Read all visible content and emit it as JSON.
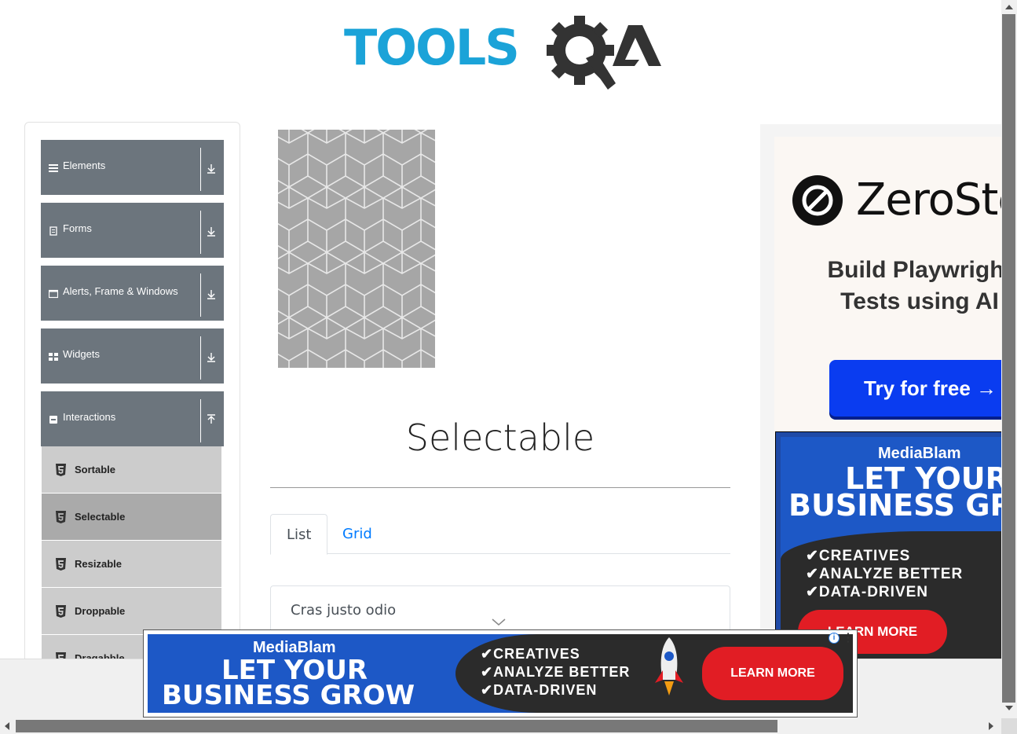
{
  "logo": {
    "text": "TOOLS",
    "qa_text": "A",
    "colors": {
      "primary": "#1ba3d8",
      "dark": "#333333"
    }
  },
  "sidebar": {
    "groups": [
      {
        "label": "Elements",
        "icon": "hamburger-icon"
      },
      {
        "label": "Forms",
        "icon": "form-icon"
      },
      {
        "label": "Alerts, Frame & Windows",
        "icon": "window-icon"
      },
      {
        "label": "Widgets",
        "icon": "grid-icon"
      },
      {
        "label": "Interactions",
        "icon": "interaction-icon",
        "expanded": true
      }
    ],
    "interaction_items": [
      {
        "label": "Sortable",
        "icon": "html5-icon"
      },
      {
        "label": "Selectable",
        "icon": "html5-icon",
        "active": true
      },
      {
        "label": "Resizable",
        "icon": "html5-icon"
      },
      {
        "label": "Droppable",
        "icon": "html5-icon"
      },
      {
        "label": "Dragabble",
        "icon": "html5-icon"
      }
    ]
  },
  "main": {
    "title": "Selectable",
    "tabs": [
      {
        "label": "List",
        "active": true
      },
      {
        "label": "Grid",
        "active": false
      }
    ],
    "list_items": [
      "Cras justo odio"
    ]
  },
  "ads": {
    "zerostep": {
      "brand": "ZeroStep",
      "tagline_line1": "Build Playwright",
      "tagline_line2": "Tests using AI",
      "button": "Try for free →",
      "colors": {
        "button": "#0a3cf0"
      }
    },
    "mediablam": {
      "brand": "MediaBlam",
      "headline_line1": "LET YOUR",
      "headline_line2": "BUSINESS GROW",
      "checks": [
        "✔CREATIVES",
        "✔ANALYZE BETTER",
        "✔DATA-DRIVEN"
      ],
      "cta": "LEARN MORE",
      "colors": {
        "blue": "#1d58c6",
        "red": "#e11d24"
      }
    },
    "info_label": "i"
  }
}
